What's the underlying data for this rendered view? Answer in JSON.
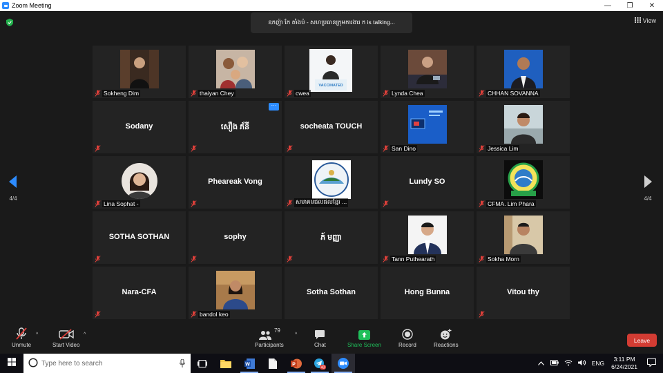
{
  "window": {
    "title": "Zoom Meeting",
    "controls": [
      "—",
      "❐",
      "✕"
    ]
  },
  "meeting": {
    "active_speaker": "ឧកញ៉ា កែ តាំងប៉ - សហប្រធានក្រុមការងារ ក is talking...",
    "view_label": "View",
    "page_indicator": "4/4"
  },
  "participants": [
    {
      "name": "Sokheng Dim",
      "video": true
    },
    {
      "name": "thaiyan Chey",
      "video": true
    },
    {
      "name": "cwea",
      "video": true,
      "photo_text": "VACCINATED"
    },
    {
      "name": "Lynda Chea",
      "video": true
    },
    {
      "name": "CHHAN SOVANNA",
      "video": true
    },
    {
      "name": "Sodany",
      "video": false
    },
    {
      "name": "សឿង ភ័នី",
      "video": false,
      "more": "···"
    },
    {
      "name": "socheata TOUCH",
      "video": false
    },
    {
      "name": "San Dino",
      "video": true
    },
    {
      "name": "Jessica Lim",
      "video": true
    },
    {
      "name": "Lina Sophat -",
      "video": true,
      "round": true
    },
    {
      "name": "Phеareak Vong",
      "video": false
    },
    {
      "name": "សមាគមជលផលខ្មែរ ...",
      "video": true
    },
    {
      "name": "Lundy SO",
      "video": false
    },
    {
      "name": "CFMA. Lim Phara",
      "video": true
    },
    {
      "name": "SOTHA SOTHAN",
      "video": false
    },
    {
      "name": "sophy",
      "video": false
    },
    {
      "name": "ភ៍ មញ្ញា",
      "video": false
    },
    {
      "name": "Tann Puthearath",
      "video": true
    },
    {
      "name": "Sokha Morn",
      "video": true
    },
    {
      "name": "Nara-CFA",
      "video": false
    },
    {
      "name": "bandol keo",
      "video": true
    },
    {
      "name": "Sotha Sothan",
      "video": false
    },
    {
      "name": "Hong Bunna",
      "video": false
    },
    {
      "name": "Vitou thy",
      "video": false
    }
  ],
  "toolbar": {
    "unmute": "Unmute",
    "start_video": "Start Video",
    "participants": "Participants",
    "participants_count": "79",
    "chat": "Chat",
    "share_screen": "Share Screen",
    "record": "Record",
    "reactions": "Reactions",
    "leave": "Leave"
  },
  "taskbar": {
    "search_placeholder": "Type here to search",
    "language": "ENG",
    "time": "3:11 PM",
    "date": "6/24/2021",
    "telegram_badge": "43"
  },
  "colors": {
    "accent": "#2d8cff",
    "share_green": "#1fbf5a",
    "muted_red": "#e0403a",
    "leave_red": "#d33c33"
  }
}
